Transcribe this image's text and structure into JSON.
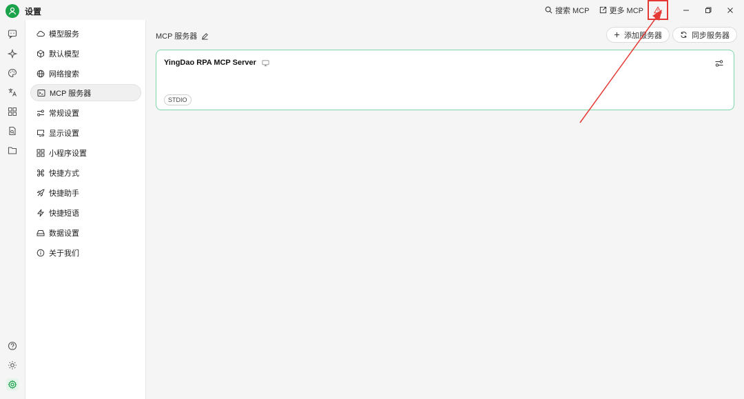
{
  "app": {
    "title": "设置"
  },
  "titlebar": {
    "search_mcp": "搜索 MCP",
    "more_mcp": "更多 MCP"
  },
  "sidebar": {
    "items": [
      {
        "label": "模型服务",
        "icon": "cloud-icon"
      },
      {
        "label": "默认模型",
        "icon": "cube-icon"
      },
      {
        "label": "网络搜索",
        "icon": "globe-icon"
      },
      {
        "label": "MCP 服务器",
        "icon": "terminal-icon",
        "active": true
      },
      {
        "label": "常规设置",
        "icon": "sliders-icon"
      },
      {
        "label": "显示设置",
        "icon": "monitor-icon"
      },
      {
        "label": "小程序设置",
        "icon": "grid-icon"
      },
      {
        "label": "快捷方式",
        "icon": "command-icon"
      },
      {
        "label": "快捷助手",
        "icon": "rocket-icon"
      },
      {
        "label": "快捷短语",
        "icon": "zap-icon"
      },
      {
        "label": "数据设置",
        "icon": "drive-icon"
      },
      {
        "label": "关于我们",
        "icon": "info-icon"
      }
    ]
  },
  "main": {
    "section_title": "MCP 服务器",
    "add_server": "添加服务器",
    "sync_servers": "同步服务器",
    "server": {
      "name": "YingDao RPA MCP Server",
      "tag": "STDIO"
    }
  },
  "colors": {
    "accent": "#1aa34a",
    "card_border": "#7ed7a8",
    "annotation_red": "#e53935"
  }
}
